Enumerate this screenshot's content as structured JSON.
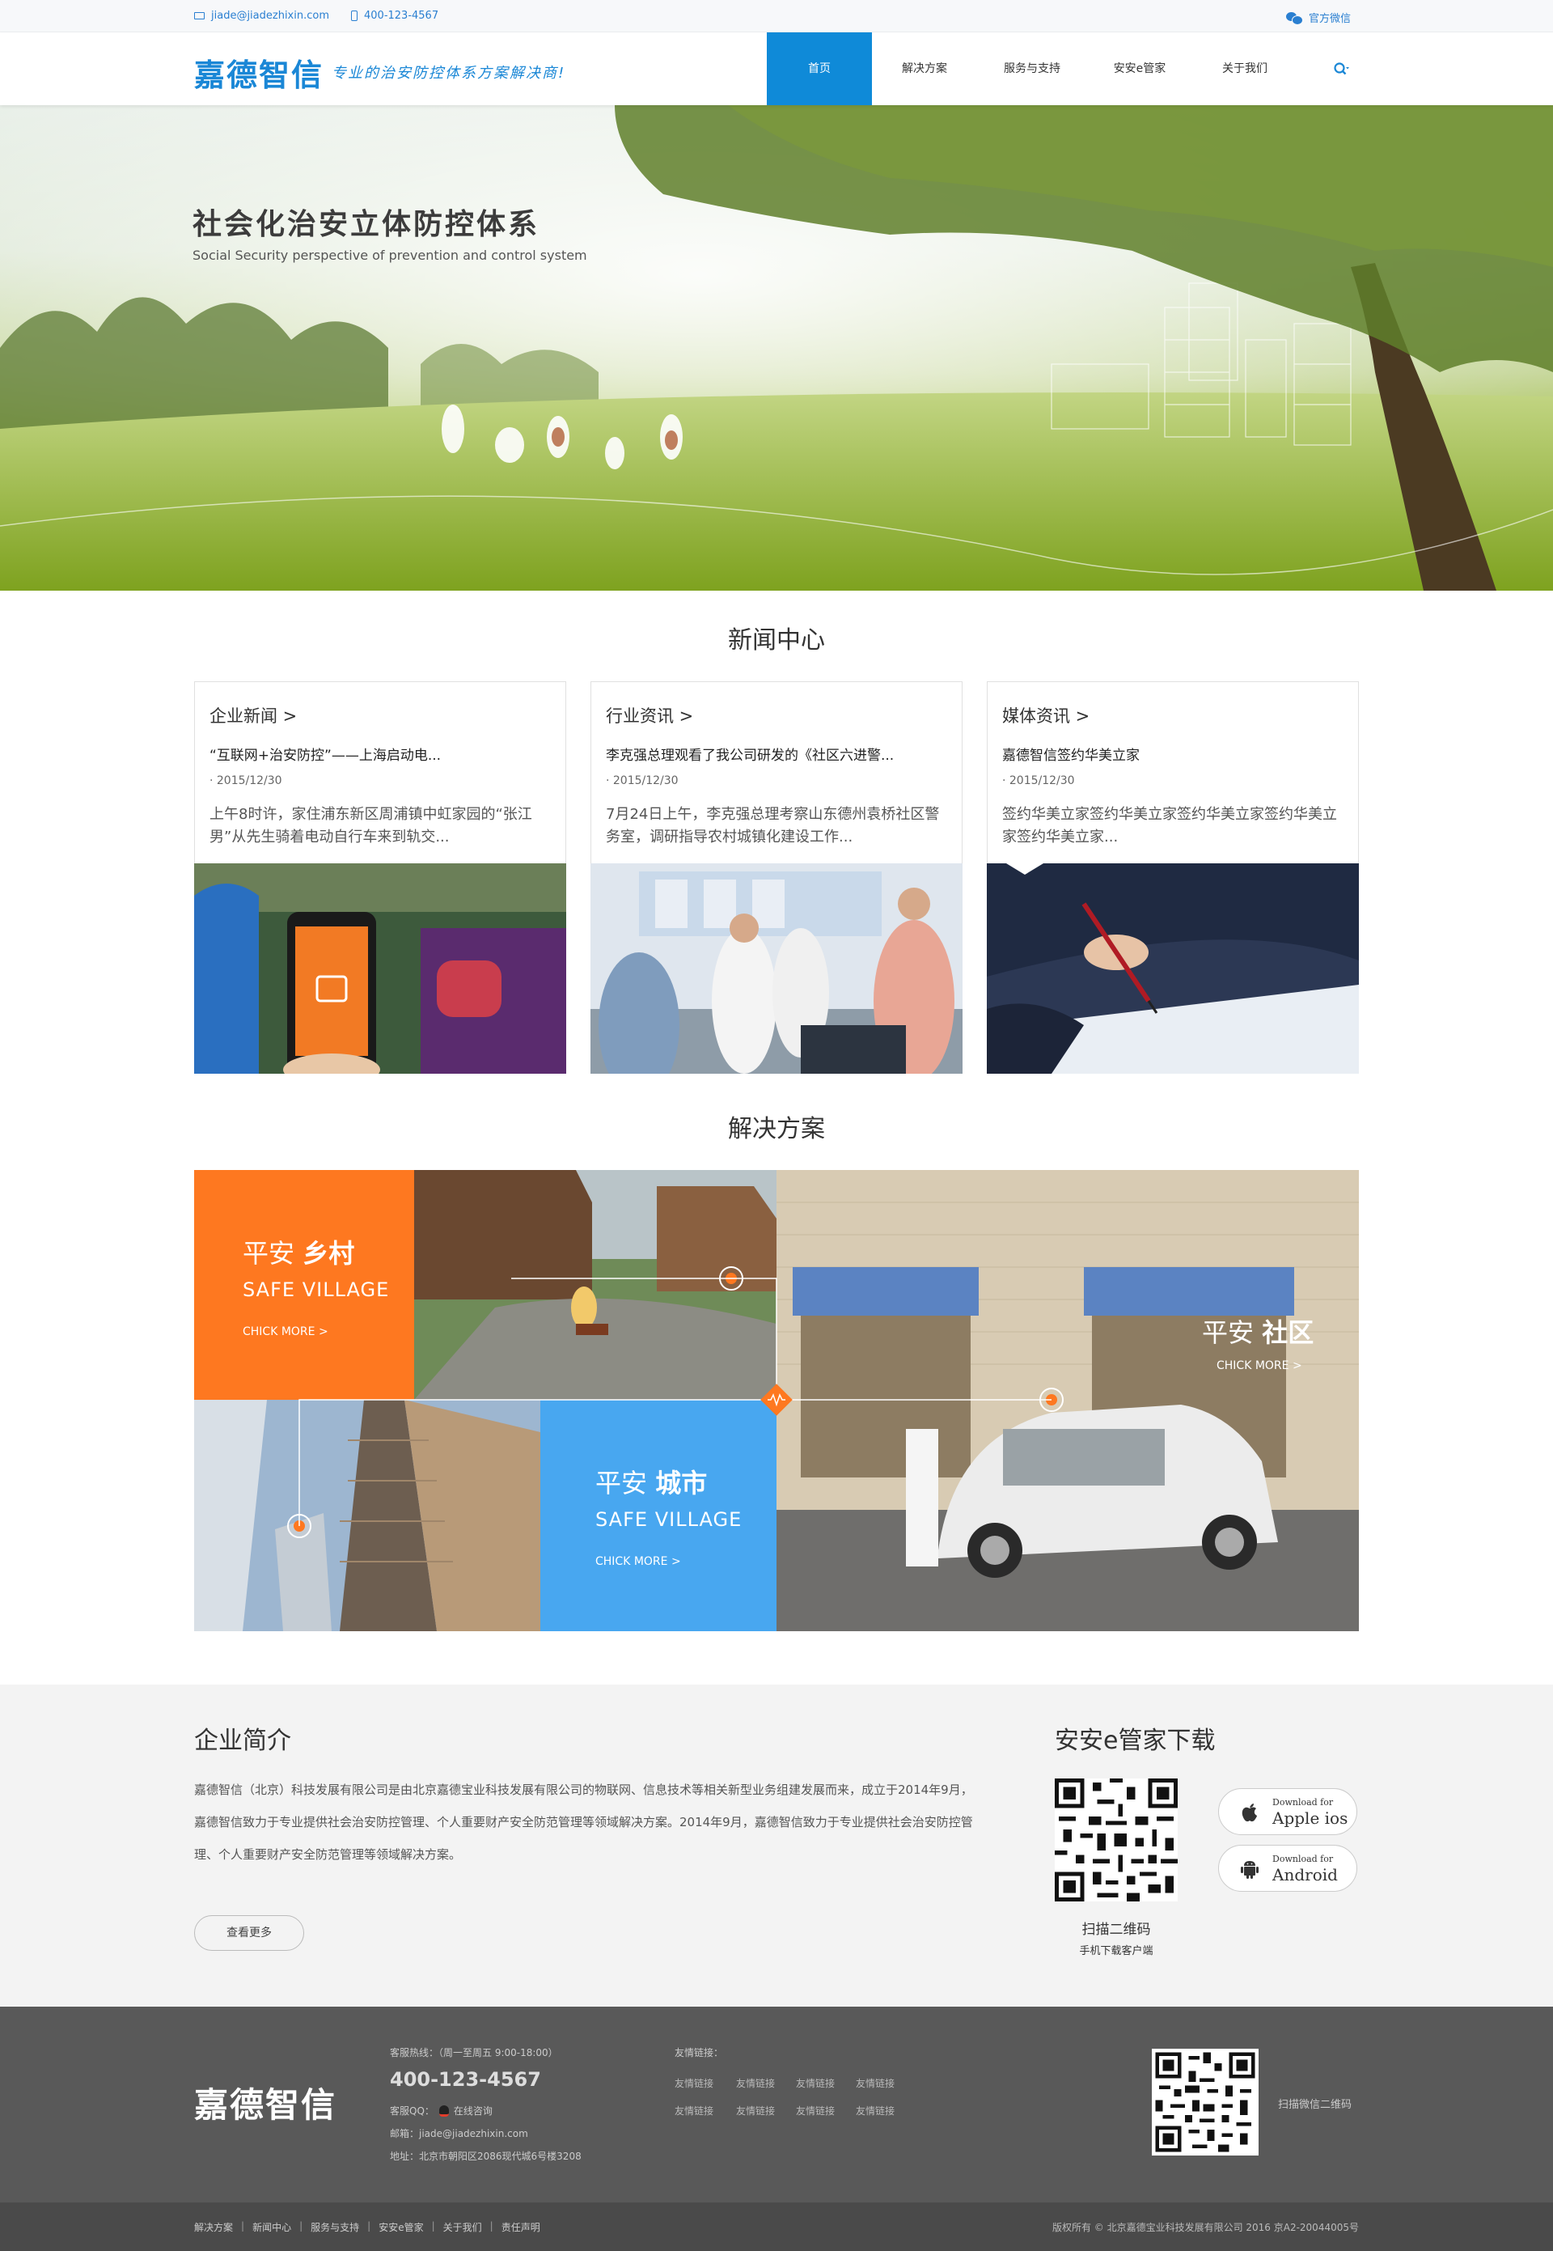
{
  "topbar": {
    "email": "jiade@jiadezhixin.com",
    "phone": "400-123-4567",
    "wechat": "官方微信"
  },
  "header": {
    "logo": "嘉德智信",
    "slogan": "专业的治安防控体系方案解决商!",
    "nav": [
      "首页",
      "解决方案",
      "服务与支持",
      "安安e管家",
      "关于我们"
    ],
    "active_nav": "首页"
  },
  "hero": {
    "title": "社会化治安立体防控体系",
    "subtitle": "Social Security perspective of prevention and control system"
  },
  "news": {
    "section_title": "新闻中心",
    "cards": [
      {
        "category": "企业新闻 >",
        "headline": "“互联网+治安防控”——上海启动电...",
        "date": "· 2015/12/30",
        "excerpt": "上午8时许，家住浦东新区周浦镇中虹家园的“张江男”从先生骑着电动自行车来到轨交..."
      },
      {
        "category": "行业资讯 >",
        "headline": "李克强总理观看了我公司研发的《社区六进警...",
        "date": "· 2015/12/30",
        "excerpt": "7月24日上午，李克强总理考察山东德州袁桥社区警务室，调研指导农村城镇化建设工作..."
      },
      {
        "category": "媒体资讯 >",
        "headline": "嘉德智信签约华美立家",
        "date": "· 2015/12/30",
        "excerpt": "签约华美立家签约华美立家签约华美立家签约华美立家签约华美立家..."
      }
    ]
  },
  "solutions": {
    "section_title": "解决方案",
    "village": {
      "prefix": "平安",
      "name": "乡村",
      "en": "SAFE VILLAGE",
      "more": "CHICK MORE >"
    },
    "community": {
      "prefix": "平安",
      "name": "社区",
      "more": "CHICK MORE >"
    },
    "city": {
      "prefix": "平安",
      "name": "城市",
      "en": "SAFE VILLAGE",
      "more": "CHICK MORE >"
    }
  },
  "intro": {
    "title": "企业简介",
    "body": "嘉德智信（北京）科技发展有限公司是由北京嘉德宝业科技发展有限公司的物联网、信息技术等相关新型业务组建发展而来，成立于2014年9月，嘉德智信致力于专业提供社会治安防控管理、个人重要财产安全防范管理等领域解决方案。2014年9月，嘉德智信致力于专业提供社会治安防控管理、个人重要财产安全防范管理等领域解决方案。",
    "more_button": "查看更多"
  },
  "download": {
    "title": "安安e管家下载",
    "qr_caption": "扫描二维码",
    "qr_sub": "手机下载客户端",
    "ios_small": "Download for",
    "ios_big": "Apple ios",
    "android_small": "Download for",
    "android_big": "Android"
  },
  "footer": {
    "logo": "嘉德智信",
    "hotline_label": "客服热线：（周一至周五 9:00-18:00）",
    "phone": "400-123-4567",
    "service_label": "客服QQ：",
    "service_link": "在线咨询",
    "email": "邮箱：jiade@jiadezhixin.com",
    "address": "地址：北京市朝阳区2086现代城6号楼3208",
    "links_label": "友情链接：",
    "links": [
      "友情链接",
      "友情链接",
      "友情链接",
      "友情链接",
      "友情链接",
      "友情链接",
      "友情链接",
      "友情链接"
    ],
    "qr_caption": "扫描微信二维码",
    "bottom_links": [
      "解决方案",
      "新闻中心",
      "服务与支持",
      "安安e管家",
      "关于我们",
      "责任声明"
    ],
    "copyright": "版权所有 © 北京嘉德宝业科技发展有限公司 2016 京A2-20044005号"
  }
}
